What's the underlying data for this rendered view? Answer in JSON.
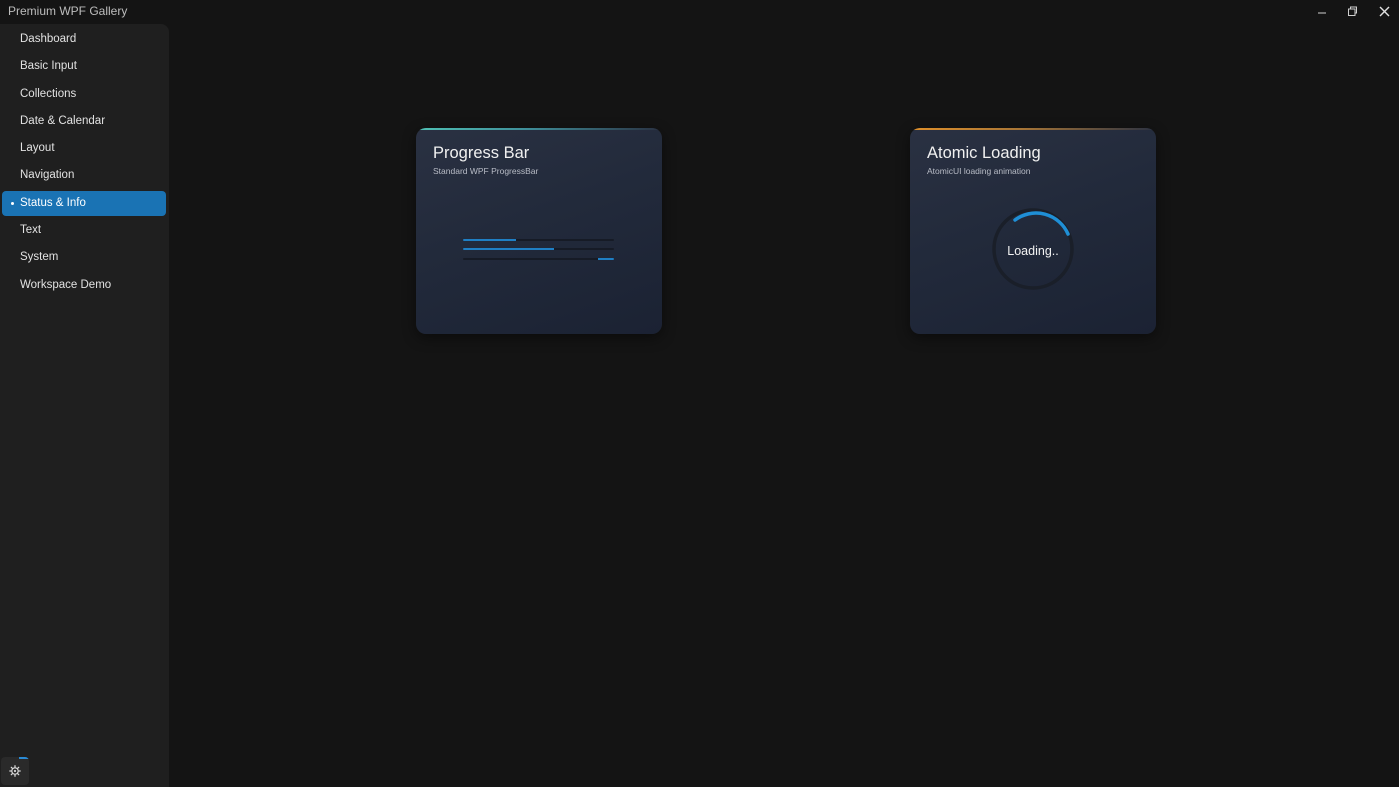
{
  "window": {
    "title": "Premium WPF Gallery",
    "controls": {
      "minimize_icon": "minimize-icon",
      "restore_icon": "restore-icon",
      "close_icon": "close-icon"
    }
  },
  "sidebar": {
    "items": [
      {
        "label": "Dashboard",
        "active": false
      },
      {
        "label": "Basic Input",
        "active": false
      },
      {
        "label": "Collections",
        "active": false
      },
      {
        "label": "Date & Calendar",
        "active": false
      },
      {
        "label": "Layout",
        "active": false
      },
      {
        "label": "Navigation",
        "active": false
      },
      {
        "label": "Status & Info",
        "active": true
      },
      {
        "label": "Text",
        "active": false
      },
      {
        "label": "System",
        "active": false
      },
      {
        "label": "Workspace Demo",
        "active": false
      }
    ],
    "settings_icon": "gear-icon"
  },
  "cards": {
    "progress": {
      "title": "Progress Bar",
      "subtitle": "Standard WPF ProgressBar",
      "accent_color": "#4fc1b5",
      "bars": [
        {
          "value": 0.35
        },
        {
          "value": 0.6
        },
        {
          "indeterminate": true
        }
      ]
    },
    "atomic": {
      "title": "Atomic Loading",
      "subtitle": "AtomicUI loading animation",
      "accent_color": "#e0902a",
      "loading_text": "Loading.."
    }
  },
  "colors": {
    "background": "#141414",
    "sidebar": "#1f1f1f",
    "accent": "#1a73b4",
    "progress_fill": "#1f7fc4"
  }
}
